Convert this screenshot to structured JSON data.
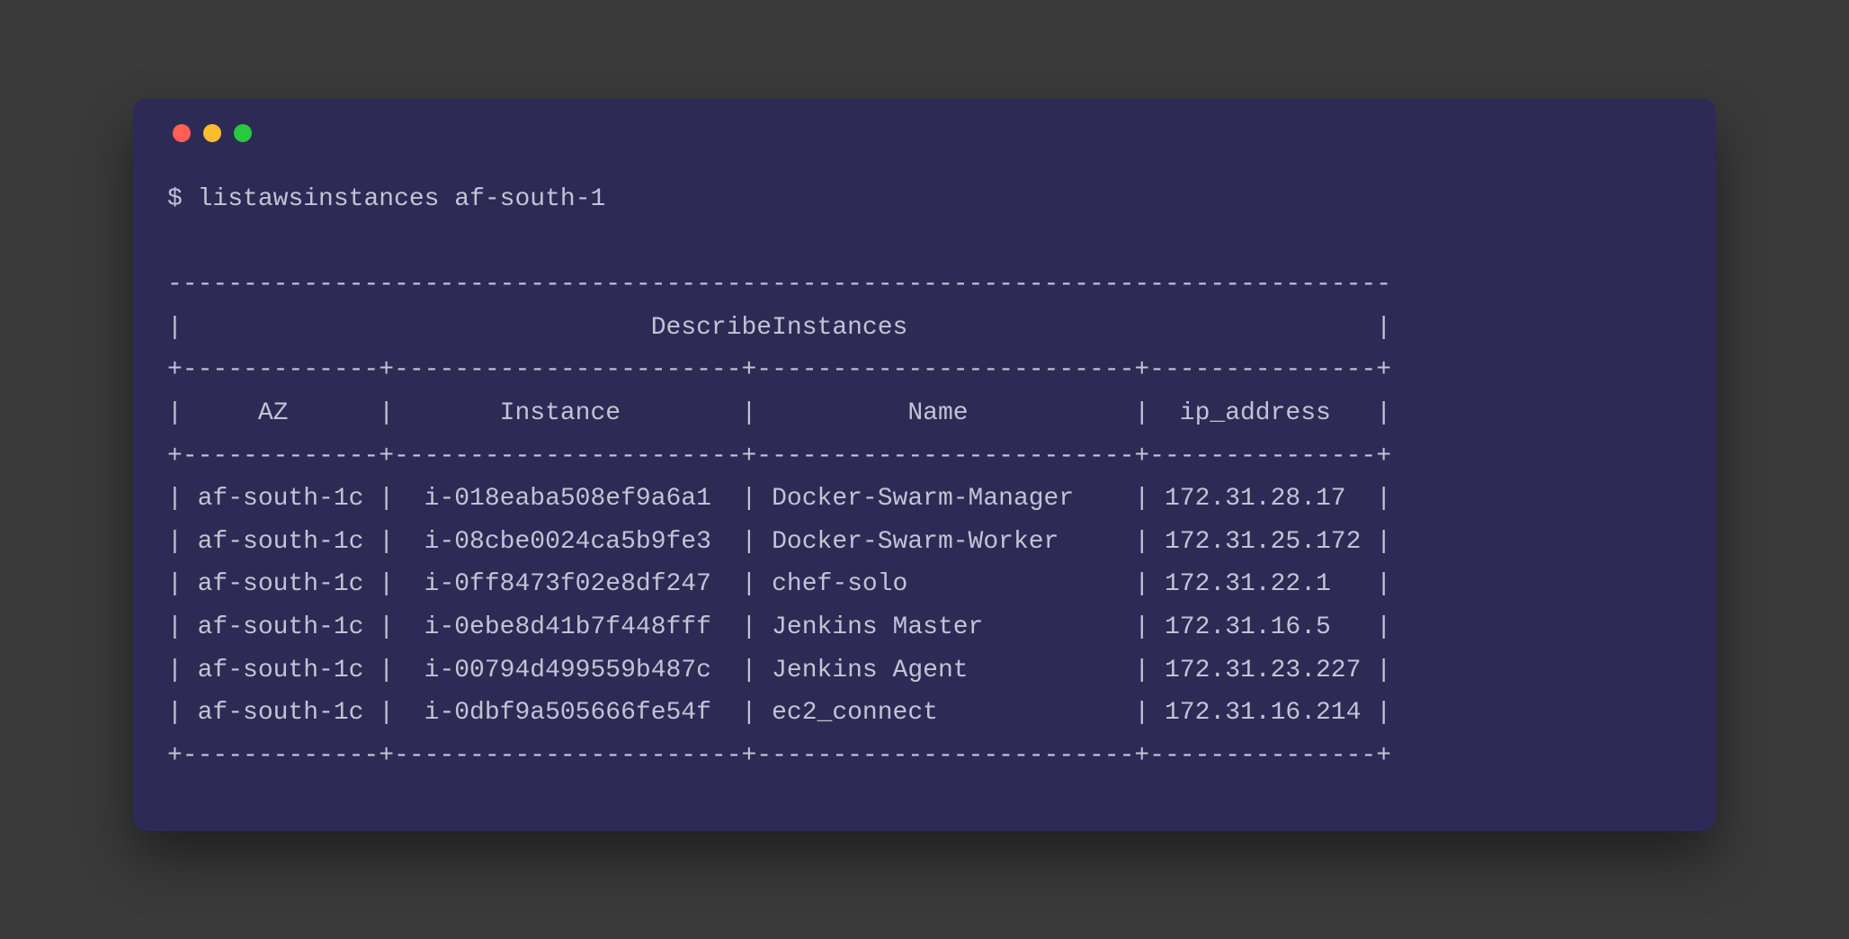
{
  "prompt": "$",
  "command": "listawsinstances af-south-1",
  "table_title": "DescribeInstances",
  "columns": [
    "AZ",
    "Instance",
    "Name",
    "ip_address"
  ],
  "rows": [
    {
      "az": "af-south-1c",
      "instance": "i-018eaba508ef9a6a1",
      "name": "Docker-Swarm-Manager",
      "ip": "172.31.28.17"
    },
    {
      "az": "af-south-1c",
      "instance": "i-08cbe0024ca5b9fe3",
      "name": "Docker-Swarm-Worker",
      "ip": "172.31.25.172"
    },
    {
      "az": "af-south-1c",
      "instance": "i-0ff8473f02e8df247",
      "name": "chef-solo",
      "ip": "172.31.22.1"
    },
    {
      "az": "af-south-1c",
      "instance": "i-0ebe8d41b7f448fff",
      "name": "Jenkins Master",
      "ip": "172.31.16.5"
    },
    {
      "az": "af-south-1c",
      "instance": "i-00794d499559b487c",
      "name": "Jenkins Agent",
      "ip": "172.31.23.227"
    },
    {
      "az": "af-south-1c",
      "instance": "i-0dbf9a505666fe54f",
      "name": "ec2_connect",
      "ip": "172.31.16.214"
    }
  ],
  "col_widths": {
    "az": 13,
    "instance": 23,
    "name": 25,
    "ip": 15
  }
}
